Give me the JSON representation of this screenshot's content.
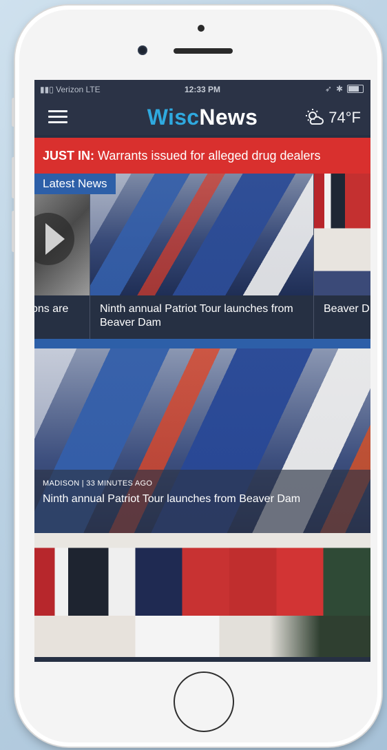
{
  "status_bar": {
    "carrier": "Verizon  LTE",
    "time": "12:33 PM"
  },
  "header": {
    "logo_part1": "Wisc",
    "logo_part2": "News",
    "temperature": "74°F",
    "menu_icon": "hamburger-menu-icon",
    "weather_icon": "partly-sunny-icon"
  },
  "breaking": {
    "label": "JUST IN:",
    "text": "Warrants issued for alleged drug dealers"
  },
  "latest": {
    "tab_label": "Latest News",
    "cards": [
      {
        "caption": "ons are"
      },
      {
        "caption": "Ninth annual Patriot Tour launches from Beaver Dam"
      },
      {
        "caption": "Beaver D Memoria"
      }
    ]
  },
  "featured": {
    "meta": "MADISON | 33 MINUTES AGO",
    "title": "Ninth annual Patriot Tour launches from Beaver Dam"
  },
  "colors": {
    "brand_blue": "#2fa9df",
    "header_bg": "#2b3346",
    "breaking_red": "#d9302e",
    "accent_blue": "#2d5fa8"
  }
}
